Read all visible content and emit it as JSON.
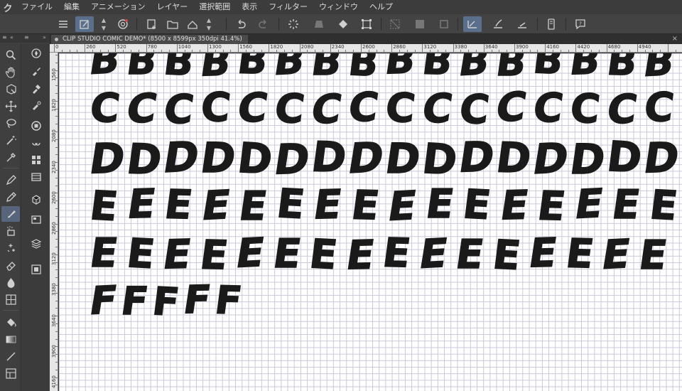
{
  "app": {
    "logo": "ク"
  },
  "menu": [
    "ファイル",
    "編集",
    "アニメーション",
    "レイヤー",
    "選択範囲",
    "表示",
    "フィルター",
    "ウィンドウ",
    "ヘルプ"
  ],
  "dock": {
    "left_arrows": "«",
    "right_arrows": "»",
    "panel_menu": "≡",
    "panel_menu_right": "≡"
  },
  "tab": {
    "title": "CLIP STUDIO COMIC DEMO* (8500 x 8599px 350dpi 41.4%)",
    "close": "×"
  },
  "ruler": {
    "h_labels": [
      "0",
      "260",
      "520",
      "780",
      "1040",
      "1300",
      "1560",
      "1820",
      "2080",
      "2340",
      "2600",
      "2860",
      "3120",
      "3380",
      "3640",
      "3900",
      "4160",
      "4420",
      "4680",
      "4940"
    ],
    "v_labels": [
      "1560",
      "1820",
      "2080",
      "2340",
      "2600",
      "2860",
      "3120",
      "3380",
      "3640",
      "3900",
      "4160"
    ]
  },
  "canvas": {
    "rows": [
      {
        "letter": "B",
        "count": 16
      },
      {
        "letter": "C",
        "count": 16
      },
      {
        "letter": "D",
        "count": 16
      },
      {
        "letter": "E",
        "count": 16
      },
      {
        "letter": "E",
        "count": 16
      },
      {
        "letter": "F",
        "count": 5
      }
    ]
  },
  "colors": {
    "accent": "#5a6f8c",
    "canvas_bg": "#ffffff",
    "grid": "#c8c8d8",
    "ink": "#1a1a1a"
  }
}
